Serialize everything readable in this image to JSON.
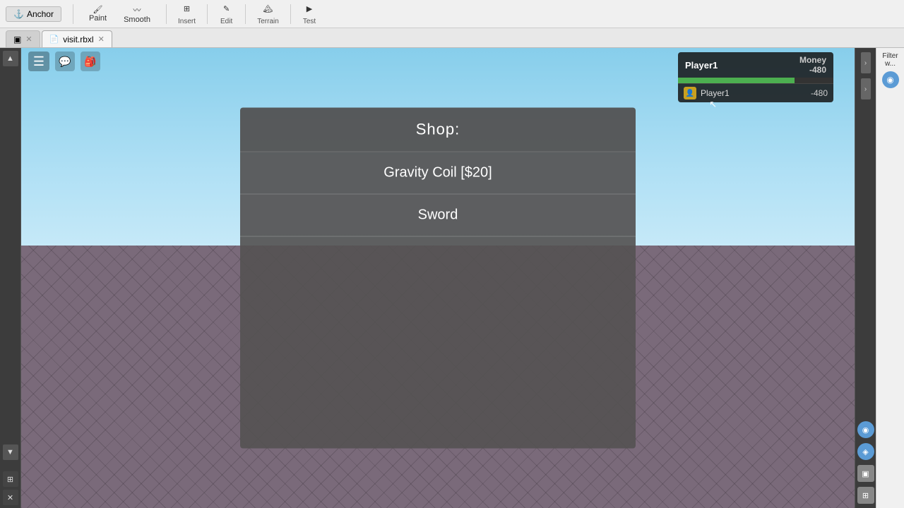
{
  "toolbar": {
    "anchor_label": "Anchor",
    "paint_label": "Paint",
    "smooth_label": "Smooth",
    "insert_label": "Insert",
    "edit_label": "Edit",
    "terrain_label": "Terrain",
    "test_label": "Test",
    "btn_arrow_down": "▾"
  },
  "tabs": [
    {
      "id": "tab-main",
      "label": "▣",
      "closable": false
    },
    {
      "id": "tab-file",
      "label": "visit.rbxl",
      "closable": true
    }
  ],
  "ingame": {
    "hamburger": "☰",
    "chat_icon": "💬",
    "bag_icon": "🎒",
    "player_name": "Player1",
    "money_label": "Money",
    "money_value": "-480",
    "player_row_name": "Player1",
    "player_row_money": "-480"
  },
  "shop": {
    "title": "Shop:",
    "items": [
      {
        "label": "Gravity Coil [$20]"
      },
      {
        "label": "Sword"
      }
    ]
  },
  "filter": {
    "label": "Filter w..."
  },
  "right_panel": {
    "icons": [
      "◉",
      "◈",
      "◇",
      "◆",
      "▣",
      "⊞"
    ]
  }
}
